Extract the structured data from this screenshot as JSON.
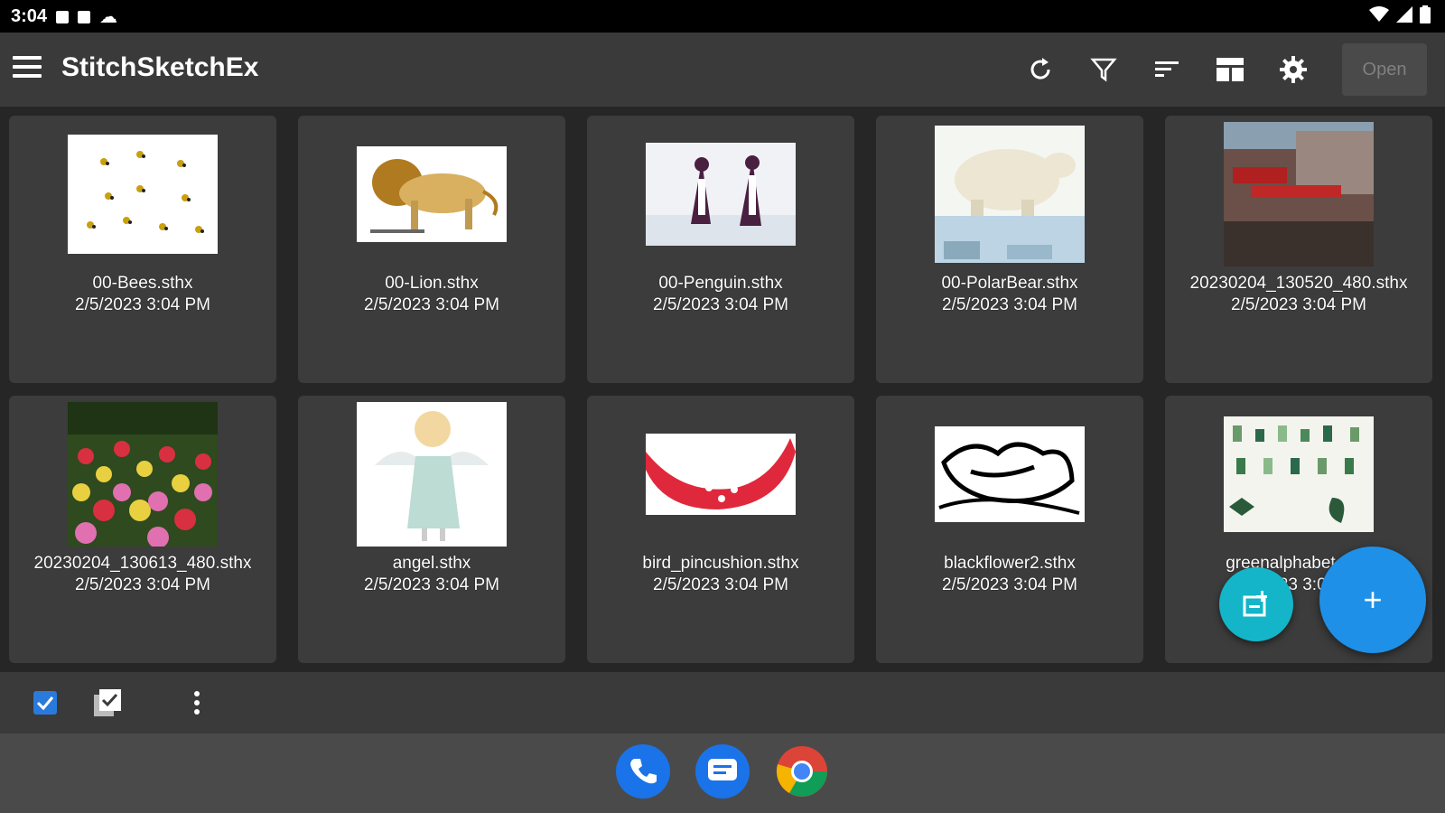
{
  "status": {
    "time": "3:04"
  },
  "app": {
    "title": "StitchSketchEx"
  },
  "toolbar": {
    "open_label": "Open",
    "icons": [
      "refresh-icon",
      "filter-icon",
      "sort-icon",
      "view-layout-icon",
      "gear-icon"
    ]
  },
  "files": [
    {
      "name": "00-Bees.sthx",
      "date": "2/5/2023 3:04 PM"
    },
    {
      "name": "00-Lion.sthx",
      "date": "2/5/2023 3:04 PM"
    },
    {
      "name": "00-Penguin.sthx",
      "date": "2/5/2023 3:04 PM"
    },
    {
      "name": "00-PolarBear.sthx",
      "date": "2/5/2023 3:04 PM"
    },
    {
      "name": "20230204_130520_480.sthx",
      "date": "2/5/2023 3:04 PM"
    },
    {
      "name": "20230204_130613_480.sthx",
      "date": "2/5/2023 3:04 PM"
    },
    {
      "name": "angel.sthx",
      "date": "2/5/2023 3:04 PM"
    },
    {
      "name": "bird_pincushion.sthx",
      "date": "2/5/2023 3:04 PM"
    },
    {
      "name": "blackflower2.sthx",
      "date": "2/5/2023 3:04 PM"
    },
    {
      "name": "greenalphabet.sthx",
      "date": "2/5/2023 3:04 PM"
    }
  ],
  "fab": {
    "add_label": "+"
  },
  "colors": {
    "accent": "#1e90e8",
    "teal": "#14b5c8",
    "appbar": "#3a3a3a",
    "card": "#3c3c3c"
  }
}
